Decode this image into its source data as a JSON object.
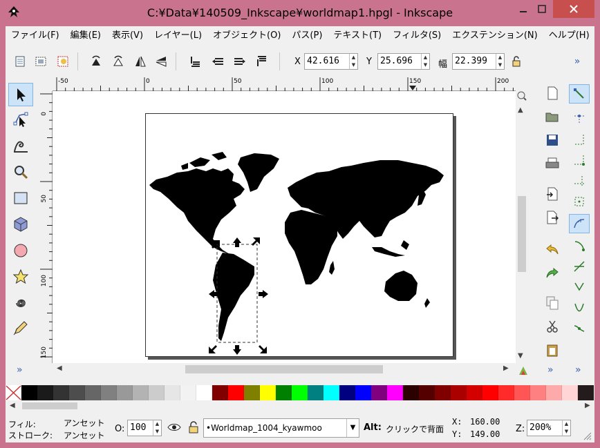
{
  "window": {
    "title": "C:¥Data¥140509_Inkscape¥worldmap1.hpgl - Inkscape"
  },
  "menu": {
    "items": [
      "ファイル(F)",
      "編集(E)",
      "表示(V)",
      "レイヤー(L)",
      "オブジェクト(O)",
      "パス(P)",
      "テキスト(T)",
      "フィルタ(S)",
      "エクステンション(N)",
      "ヘルプ(H)"
    ]
  },
  "toolbar": {
    "x_label": "X",
    "x_value": "42.616",
    "y_label": "Y",
    "y_value": "25.696",
    "w_label": "幅",
    "w_value": "22.399",
    "overflow": "»"
  },
  "ruler": {
    "h_ticks": [
      "-50",
      "0",
      "50",
      "100",
      "150",
      "200"
    ],
    "v_ticks": [
      "0",
      "50",
      "100",
      "150"
    ]
  },
  "toolbox": {
    "overflow": "»"
  },
  "commands": {
    "overflow": "»"
  },
  "snap": {
    "overflow": "»"
  },
  "palette": {
    "colors": [
      "#000000",
      "#1a1a1a",
      "#333333",
      "#4d4d4d",
      "#666666",
      "#808080",
      "#999999",
      "#b3b3b3",
      "#cccccc",
      "#e6e6e6",
      "#f2f2f2",
      "#ffffff",
      "#800000",
      "#ff0000",
      "#808000",
      "#ffff00",
      "#008000",
      "#00ff00",
      "#008080",
      "#00ffff",
      "#000080",
      "#0000ff",
      "#800080",
      "#ff00ff",
      "#2b0000",
      "#550000",
      "#800000",
      "#aa0000",
      "#d40000",
      "#ff0000",
      "#ff2a2a",
      "#ff5555",
      "#ff8080",
      "#ffaaaa",
      "#ffd5d5",
      "#241c1c"
    ]
  },
  "status": {
    "fill_label": "フィル:",
    "fill_value": "アンセット",
    "stroke_label": "ストローク:",
    "stroke_value": "アンセット",
    "opacity_label": "O:",
    "opacity_value": "100",
    "layer_value": "•Worldmap_1004_kyawmoo",
    "alt_label": "Alt:",
    "message": "クリックで背面",
    "x_label": "X:",
    "x_value": "160.00",
    "y_label": "Y:",
    "y_value": "149.00",
    "zoom_label": "Z:",
    "zoom_value": "200%"
  }
}
